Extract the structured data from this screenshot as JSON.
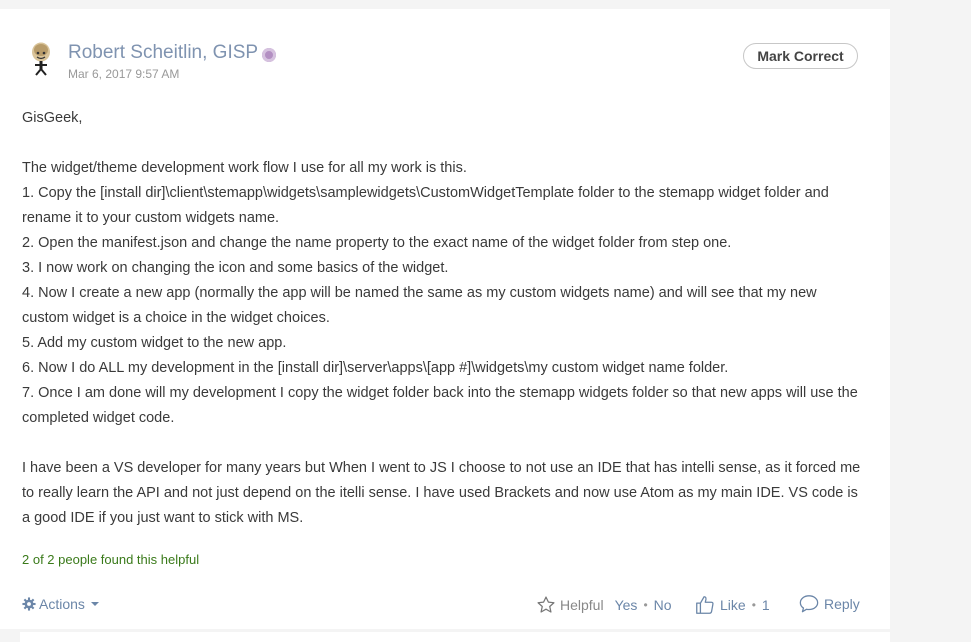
{
  "post": {
    "author": "Robert Scheitlin, GISP",
    "date": "Mar 6, 2017 9:57 AM",
    "mark_correct_label": "Mark Correct",
    "body": {
      "greeting": "GisGeek,",
      "intro": "The widget/theme development work flow I use for all my work is this.",
      "steps": [
        "1. Copy the [install dir]\\client\\stemapp\\widgets\\samplewidgets\\CustomWidgetTemplate folder to the stemapp widget folder and rename it to your custom widgets name.",
        "2. Open the manifest.json and change the name property to the exact name of the widget folder from step one.",
        "3. I now work on changing the icon and some basics of the widget.",
        "4. Now I create a new app (normally the app will be named the same as my custom widgets name) and will see that my new custom widget is a choice in the widget choices.",
        "5. Add my custom widget to the new app.",
        "6. Now I do ALL my development in the [install dir]\\server\\apps\\[app #]\\widgets\\my custom widget name folder.",
        "7. Once I am done will my development I copy the widget folder back into the stemapp widgets folder so that new apps will use the completed widget code."
      ],
      "closing": "I have been a VS developer for many years but When I went to JS I choose to not use an IDE that has intelli sense, as it forced me to really learn the API and not just depend on the itelli sense. I have used Brackets and now use Atom as my main IDE. VS code is a good IDE if you just want to stick with MS."
    },
    "helpful_count_text": "2 of 2 people found this helpful",
    "footer": {
      "actions_label": "Actions",
      "helpful_label": "Helpful",
      "yes_label": "Yes",
      "no_label": "No",
      "like_label": "Like",
      "like_count": "1",
      "reply_label": "Reply"
    },
    "icons": {
      "badge": "rank-badge-icon",
      "actions": "gear-icon",
      "helpful": "star-icon",
      "like": "thumbs-up-icon",
      "reply": "speech-bubble-icon"
    },
    "colors": {
      "link": "#6b86a8",
      "author": "#7f93b0",
      "helpful_text": "#3a7a1a",
      "badge": "#b38fc2"
    }
  }
}
